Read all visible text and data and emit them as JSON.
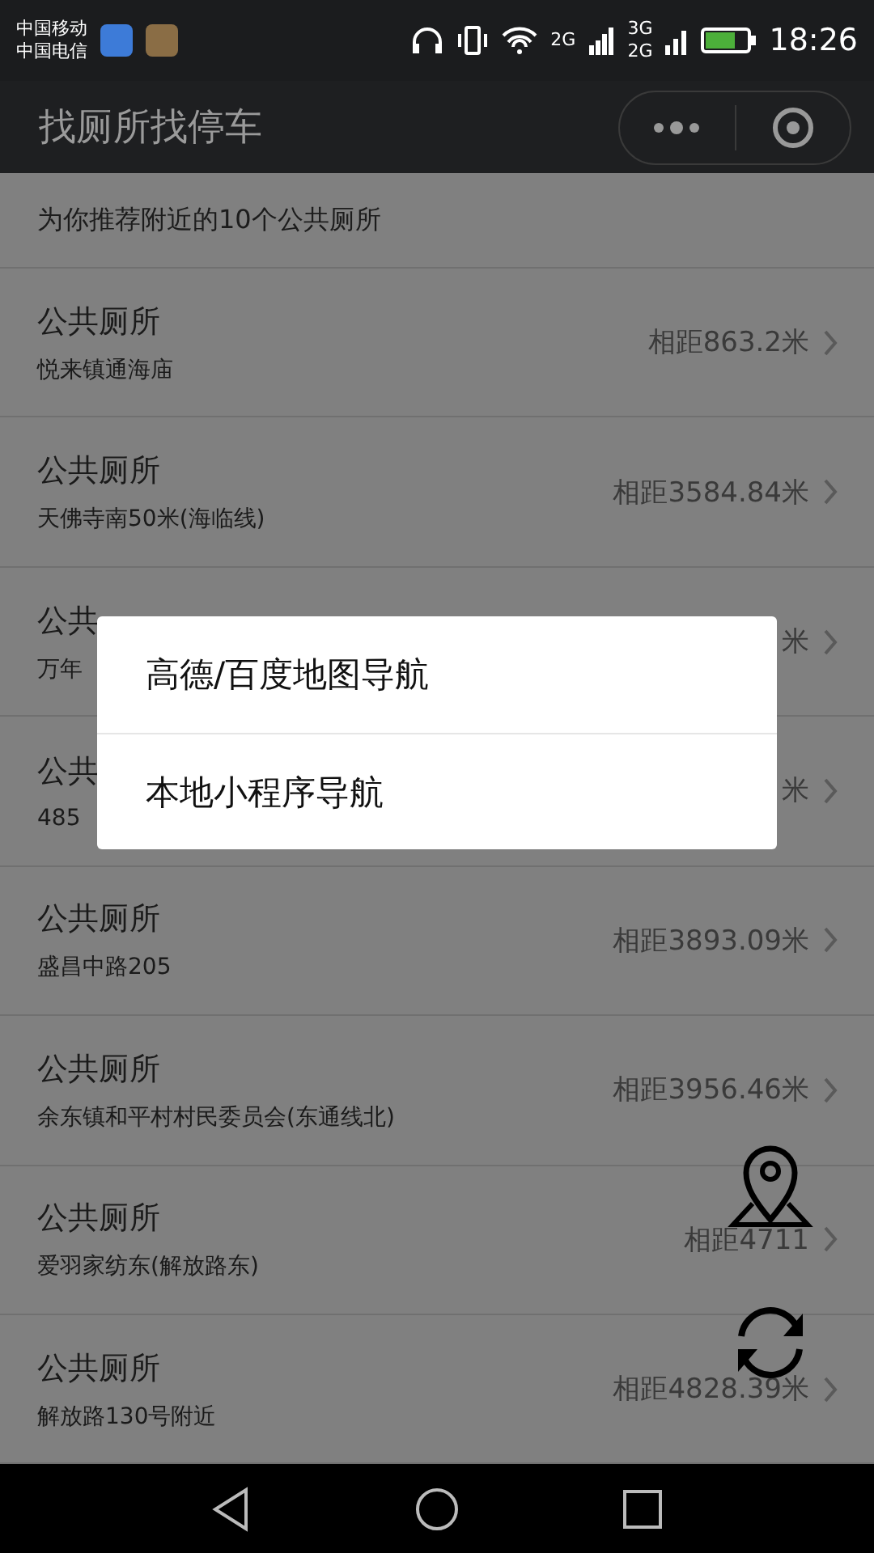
{
  "status_bar": {
    "carriers": [
      "中国移动",
      "中国电信"
    ],
    "network_1": "2G",
    "network_2_top": "3G",
    "network_2_bottom": "2G",
    "time": "18:26"
  },
  "header": {
    "title": "找厕所找停车"
  },
  "list": {
    "heading": "为你推荐附近的10个公共厕所",
    "rows": [
      {
        "title": "公共厕所",
        "address": "悦来镇通海庙",
        "distance": "相距863.2米"
      },
      {
        "title": "公共厕所",
        "address": "天佛寺南50米(海临线)",
        "distance": "相距3584.84米"
      },
      {
        "title": "公共",
        "address": "万年",
        "distance": "米"
      },
      {
        "title": "公共",
        "address": "485",
        "distance": "米"
      },
      {
        "title": "公共厕所",
        "address": "盛昌中路205",
        "distance": "相距3893.09米"
      },
      {
        "title": "公共厕所",
        "address": "余东镇和平村村民委员会(东通线北)",
        "distance": "相距3956.46米"
      },
      {
        "title": "公共厕所",
        "address": "爱羽家纺东(解放路东)",
        "distance": "相距4711"
      },
      {
        "title": "公共厕所",
        "address": "解放路130号附近",
        "distance": "相距4828.39米"
      }
    ]
  },
  "action_sheet": {
    "options": [
      "高德/百度地图导航",
      "本地小程序导航"
    ]
  }
}
